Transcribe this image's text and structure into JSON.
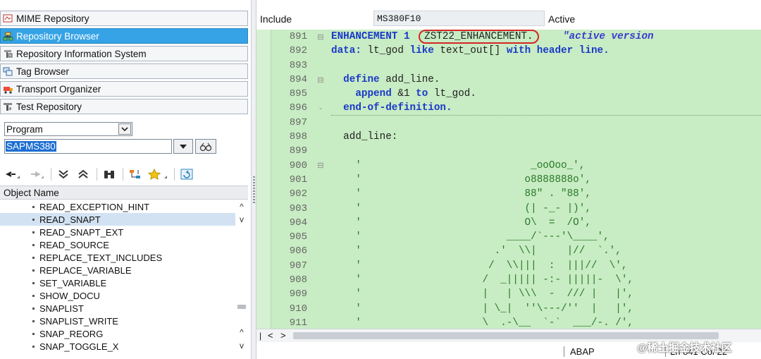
{
  "nav": {
    "items": [
      {
        "label": "MIME Repository",
        "icon": "mime-repo-icon"
      },
      {
        "label": "Repository Browser",
        "icon": "repo-browser-icon",
        "active": true
      },
      {
        "label": "Repository Information System",
        "icon": "repo-info-icon"
      },
      {
        "label": "Tag Browser",
        "icon": "tag-browser-icon"
      },
      {
        "label": "Transport Organizer",
        "icon": "transport-icon"
      },
      {
        "label": "Test Repository",
        "icon": "test-repo-icon"
      }
    ]
  },
  "object_type": {
    "value": "Program"
  },
  "object_input": {
    "value": "SAPMS380"
  },
  "object_list": {
    "header": "Object Name",
    "items": [
      "READ_EXCEPTION_HINT",
      "READ_SNAPT",
      "READ_SNAPT_EXT",
      "READ_SOURCE",
      "REPLACE_TEXT_INCLUDES",
      "REPLACE_VARIABLE",
      "SET_VARIABLE",
      "SHOW_DOCU",
      "SNAPLIST",
      "SNAPLIST_WRITE",
      "SNAP_REORG",
      "SNAP_TOGGLE_X"
    ],
    "selected": "READ_SNAPT"
  },
  "editor": {
    "include_label": "Include",
    "include_name": "MS380F10",
    "status": "Active",
    "line_numbers": [
      "891",
      "892",
      "893",
      "894",
      "895",
      "896",
      "897",
      "898",
      "899",
      "900",
      "901",
      "902",
      "903",
      "904",
      "905",
      "906",
      "907",
      "908",
      "909",
      "910",
      "911"
    ],
    "lines": {
      "l891_kw": "ENHANCEMENT 1",
      "l891_name": "ZST22_ENHANCEMENT.",
      "l891_comment": "\"active version",
      "l892_a": "data:",
      "l892_b": " lt_god ",
      "l892_c": "like",
      "l892_d": " text_out[] ",
      "l892_e": "with header line.",
      "l894_a": "  define",
      "l894_b": " add_line.",
      "l895_a": "    append",
      "l895_b": " &1 ",
      "l895_c": "to",
      "l895_d": " lt_god.",
      "l896": "  end-of-definition.",
      "l898": "  add_line:",
      "art": [
        "    '                            _ooOoo_',",
        "    '                           o8888888o',",
        "    '                           88\" . \"88',",
        "    '                           (| -_- |)',",
        "    '                           O\\  =  /O',",
        "    '                        ____/`---'\\____',",
        "    '                      .'  \\\\|     |//  `.',",
        "    '                     /  \\\\|||  :  |||//  \\',",
        "    '                    /  _||||| -:- |||||-  \\',",
        "    '                    |   | \\\\\\  -  /// |   |',",
        "    '                    | \\_|  ''\\---/''  |   |',",
        "    '                    \\  .-\\__  `-`  ___/-. /',"
      ]
    }
  },
  "status_bar": {
    "language": "ABAP",
    "position": "Ln 841 Col 22"
  },
  "watermark": "@稀土掘金技术社区"
}
